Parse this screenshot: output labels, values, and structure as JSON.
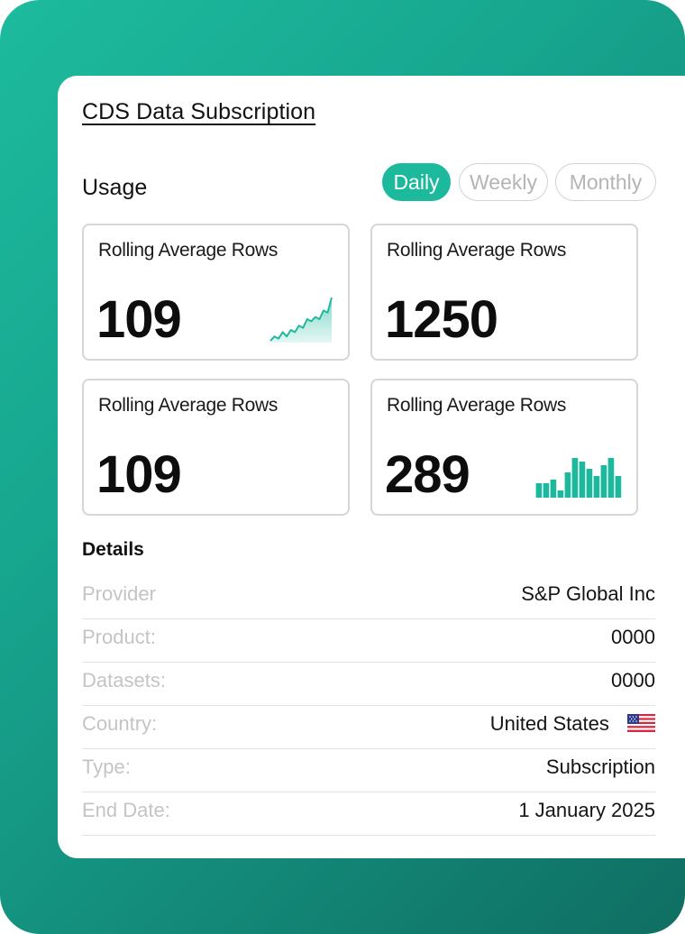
{
  "title": "CDS Data Subscription",
  "usage": {
    "label": "Usage",
    "tabs": [
      {
        "label": "Daily",
        "active": true
      },
      {
        "label": "Weekly",
        "active": false
      },
      {
        "label": "Monthly",
        "active": false
      }
    ]
  },
  "metrics": [
    {
      "label": "Rolling Average Rows",
      "value": "109",
      "chart": "line-sparkline",
      "series": [
        2,
        4,
        3,
        6,
        4,
        7,
        6,
        9,
        8,
        12,
        11,
        13,
        12,
        16,
        15,
        22
      ]
    },
    {
      "label": "Rolling Average Rows",
      "value": "1250",
      "chart": null
    },
    {
      "label": "Rolling Average Rows",
      "value": "109",
      "chart": null
    },
    {
      "label": "Rolling Average Rows",
      "value": "289",
      "chart": "bar-sparkline",
      "series": [
        4,
        4,
        5,
        2,
        7,
        11,
        10,
        8,
        6,
        9,
        11,
        6
      ]
    }
  ],
  "details": {
    "label": "Details",
    "rows": [
      {
        "key": "Provider",
        "value": "S&P  Global Inc"
      },
      {
        "key": "Product:",
        "value": "0000"
      },
      {
        "key": "Datasets:",
        "value": "0000"
      },
      {
        "key": "Country:",
        "value": "United States",
        "icon": "us-flag-icon"
      },
      {
        "key": "Type:",
        "value": "Subscription"
      },
      {
        "key": "End Date:",
        "value": "1 January 2025"
      }
    ]
  },
  "colors": {
    "accent": "#1db99d",
    "gradient_start": "#1dbb9e",
    "gradient_end": "#0f6e62"
  }
}
